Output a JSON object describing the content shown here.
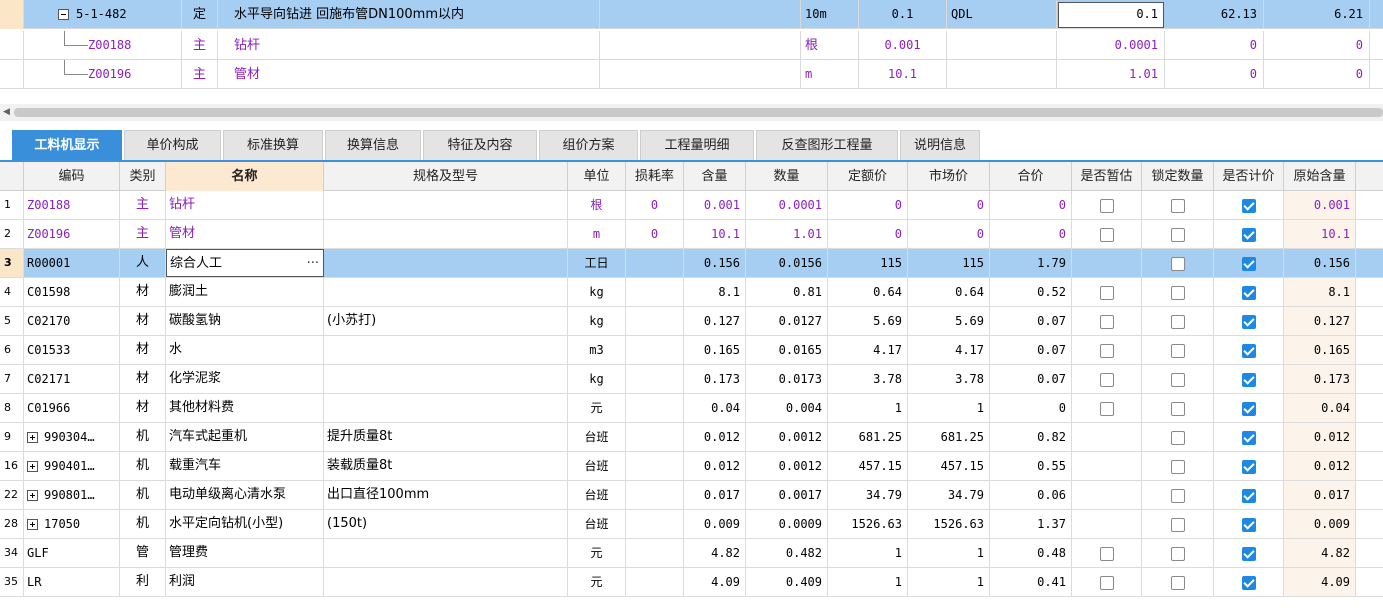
{
  "top_rows": [
    {
      "code": "5-1-482",
      "type": "定",
      "name": "水平导向钻进 回施布管DN100mm以内",
      "unit": "10m",
      "qty": "0.1",
      "flag": "QDL",
      "amount": "0.1",
      "price": "62.13",
      "total": "6.21"
    },
    {
      "code": "Z00188",
      "type": "主",
      "name": "钻杆",
      "unit": "根",
      "qty": "0.001",
      "flag": "",
      "amount": "0.0001",
      "price": "0",
      "total": "0"
    },
    {
      "code": "Z00196",
      "type": "主",
      "name": "管材",
      "unit": "m",
      "qty": "10.1",
      "flag": "",
      "amount": "1.01",
      "price": "0",
      "total": "0"
    }
  ],
  "tabs": [
    "工料机显示",
    "单价构成",
    "标准换算",
    "换算信息",
    "特征及内容",
    "组价方案",
    "工程量明细",
    "反查图形工程量",
    "说明信息"
  ],
  "columns": [
    "编码",
    "类别",
    "名称",
    "规格及型号",
    "单位",
    "损耗率",
    "含量",
    "数量",
    "定额价",
    "市场价",
    "合价",
    "是否暂估",
    "锁定数量",
    "是否计价",
    "原始含量"
  ],
  "rows": [
    {
      "no": "1",
      "code": "Z00188",
      "type": "主",
      "name": "钻杆",
      "spec": "",
      "unit": "根",
      "loss": "0",
      "content": "0.001",
      "qty": "0.0001",
      "base": "0",
      "market": "0",
      "total": "0",
      "est": "box",
      "lock": "box",
      "priced": "on",
      "orig": "0.001",
      "purple": true
    },
    {
      "no": "2",
      "code": "Z00196",
      "type": "主",
      "name": "管材",
      "spec": "",
      "unit": "m",
      "loss": "0",
      "content": "10.1",
      "qty": "1.01",
      "base": "0",
      "market": "0",
      "total": "0",
      "est": "box",
      "lock": "box",
      "priced": "on",
      "orig": "10.1",
      "purple": true
    },
    {
      "no": "3",
      "code": "R00001",
      "type": "人",
      "name": "综合人工",
      "spec": "",
      "unit": "工日",
      "loss": "",
      "content": "0.156",
      "qty": "0.0156",
      "base": "115",
      "market": "115",
      "total": "1.79",
      "est": "",
      "lock": "box",
      "priced": "on",
      "orig": "0.156",
      "selected": true
    },
    {
      "no": "4",
      "code": "C01598",
      "type": "材",
      "name": "膨润土",
      "spec": "",
      "unit": "kg",
      "loss": "",
      "content": "8.1",
      "qty": "0.81",
      "base": "0.64",
      "market": "0.64",
      "total": "0.52",
      "est": "box",
      "lock": "box",
      "priced": "on",
      "orig": "8.1"
    },
    {
      "no": "5",
      "code": "C02170",
      "type": "材",
      "name": "碳酸氢钠",
      "spec": "(小苏打)",
      "unit": "kg",
      "loss": "",
      "content": "0.127",
      "qty": "0.0127",
      "base": "5.69",
      "market": "5.69",
      "total": "0.07",
      "est": "box",
      "lock": "box",
      "priced": "on",
      "orig": "0.127"
    },
    {
      "no": "6",
      "code": "C01533",
      "type": "材",
      "name": "水",
      "spec": "",
      "unit": "m3",
      "loss": "",
      "content": "0.165",
      "qty": "0.0165",
      "base": "4.17",
      "market": "4.17",
      "total": "0.07",
      "est": "box",
      "lock": "box",
      "priced": "on",
      "orig": "0.165"
    },
    {
      "no": "7",
      "code": "C02171",
      "type": "材",
      "name": "化学泥浆",
      "spec": "",
      "unit": "kg",
      "loss": "",
      "content": "0.173",
      "qty": "0.0173",
      "base": "3.78",
      "market": "3.78",
      "total": "0.07",
      "est": "box",
      "lock": "box",
      "priced": "on",
      "orig": "0.173"
    },
    {
      "no": "8",
      "code": "C01966",
      "type": "材",
      "name": "其他材料费",
      "spec": "",
      "unit": "元",
      "loss": "",
      "content": "0.04",
      "qty": "0.004",
      "base": "1",
      "market": "1",
      "total": "0",
      "est": "box",
      "lock": "box",
      "priced": "on",
      "orig": "0.04"
    },
    {
      "no": "9",
      "code": "990304…",
      "type": "机",
      "name": "汽车式起重机",
      "spec": "提升质量8t",
      "unit": "台班",
      "loss": "",
      "content": "0.012",
      "qty": "0.0012",
      "base": "681.25",
      "market": "681.25",
      "total": "0.82",
      "est": "",
      "lock": "box",
      "priced": "on",
      "orig": "0.012",
      "expand": true
    },
    {
      "no": "16",
      "code": "990401…",
      "type": "机",
      "name": "载重汽车",
      "spec": "装载质量8t",
      "unit": "台班",
      "loss": "",
      "content": "0.012",
      "qty": "0.0012",
      "base": "457.15",
      "market": "457.15",
      "total": "0.55",
      "est": "",
      "lock": "box",
      "priced": "on",
      "orig": "0.012",
      "expand": true
    },
    {
      "no": "22",
      "code": "990801…",
      "type": "机",
      "name": "电动单级离心清水泵",
      "spec": "出口直径100mm",
      "unit": "台班",
      "loss": "",
      "content": "0.017",
      "qty": "0.0017",
      "base": "34.79",
      "market": "34.79",
      "total": "0.06",
      "est": "",
      "lock": "box",
      "priced": "on",
      "orig": "0.017",
      "expand": true
    },
    {
      "no": "28",
      "code": "17050",
      "type": "机",
      "name": "水平定向钻机(小型)",
      "spec": "(150t)",
      "unit": "台班",
      "loss": "",
      "content": "0.009",
      "qty": "0.0009",
      "base": "1526.63",
      "market": "1526.63",
      "total": "1.37",
      "est": "",
      "lock": "box",
      "priced": "on",
      "orig": "0.009",
      "expand": true
    },
    {
      "no": "34",
      "code": "GLF",
      "type": "管",
      "name": "管理费",
      "spec": "",
      "unit": "元",
      "loss": "",
      "content": "4.82",
      "qty": "0.482",
      "base": "1",
      "market": "1",
      "total": "0.48",
      "est": "box",
      "lock": "box",
      "priced": "on",
      "orig": "4.82"
    },
    {
      "no": "35",
      "code": "LR",
      "type": "利",
      "name": "利润",
      "spec": "",
      "unit": "元",
      "loss": "",
      "content": "4.09",
      "qty": "0.409",
      "base": "1",
      "market": "1",
      "total": "0.41",
      "est": "box",
      "lock": "box",
      "priced": "on",
      "orig": "4.09"
    }
  ],
  "colors": {
    "accent": "#3a8fdb",
    "selected_row": "#a6cdf2",
    "purple_text": "#8b1fbd",
    "checkbox_on": "#1e88e5"
  }
}
